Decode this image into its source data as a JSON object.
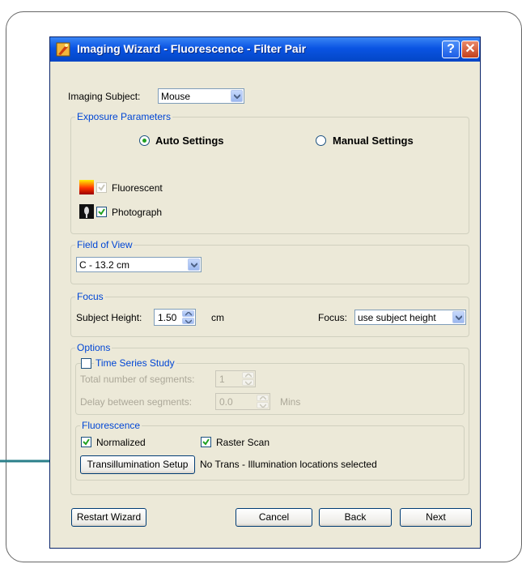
{
  "window": {
    "title": "Imaging Wizard - Fluorescence - Filter Pair",
    "help_glyph": "?",
    "close_glyph": "✕"
  },
  "imaging_subject": {
    "label": "Imaging Subject:",
    "value": "Mouse"
  },
  "exposure": {
    "legend": "Exposure Parameters",
    "auto_label": "Auto Settings",
    "manual_label": "Manual Settings",
    "selected": "auto",
    "fluorescent": {
      "label": "Fluorescent",
      "checked": true,
      "enabled": false
    },
    "photograph": {
      "label": "Photograph",
      "checked": true,
      "enabled": true
    }
  },
  "field_of_view": {
    "legend": "Field of View",
    "value": "C - 13.2 cm"
  },
  "focus": {
    "legend": "Focus",
    "height_label": "Subject Height:",
    "height_value": "1.50",
    "height_unit": "cm",
    "focus_label": "Focus:",
    "focus_value": "use subject height"
  },
  "options": {
    "legend": "Options",
    "time_series": {
      "label": "Time Series Study",
      "checked": false,
      "segments_label": "Total number of segments:",
      "segments_value": "1",
      "delay_label": "Delay between segments:",
      "delay_value": "0.0",
      "delay_unit": "Mins"
    },
    "fluorescence": {
      "legend": "Fluorescence",
      "normalized": {
        "label": "Normalized",
        "checked": true
      },
      "raster": {
        "label": "Raster Scan",
        "checked": true
      },
      "trans_button": "Transillumination Setup",
      "trans_status": "No Trans - Illumination locations selected"
    }
  },
  "footer": {
    "restart": "Restart Wizard",
    "cancel": "Cancel",
    "back": "Back",
    "next": "Next"
  },
  "colors": {
    "arrow": "#2a7f8a",
    "title_bar": "#0a54e3",
    "group_legend": "#0046d5",
    "check": "#21a121"
  }
}
